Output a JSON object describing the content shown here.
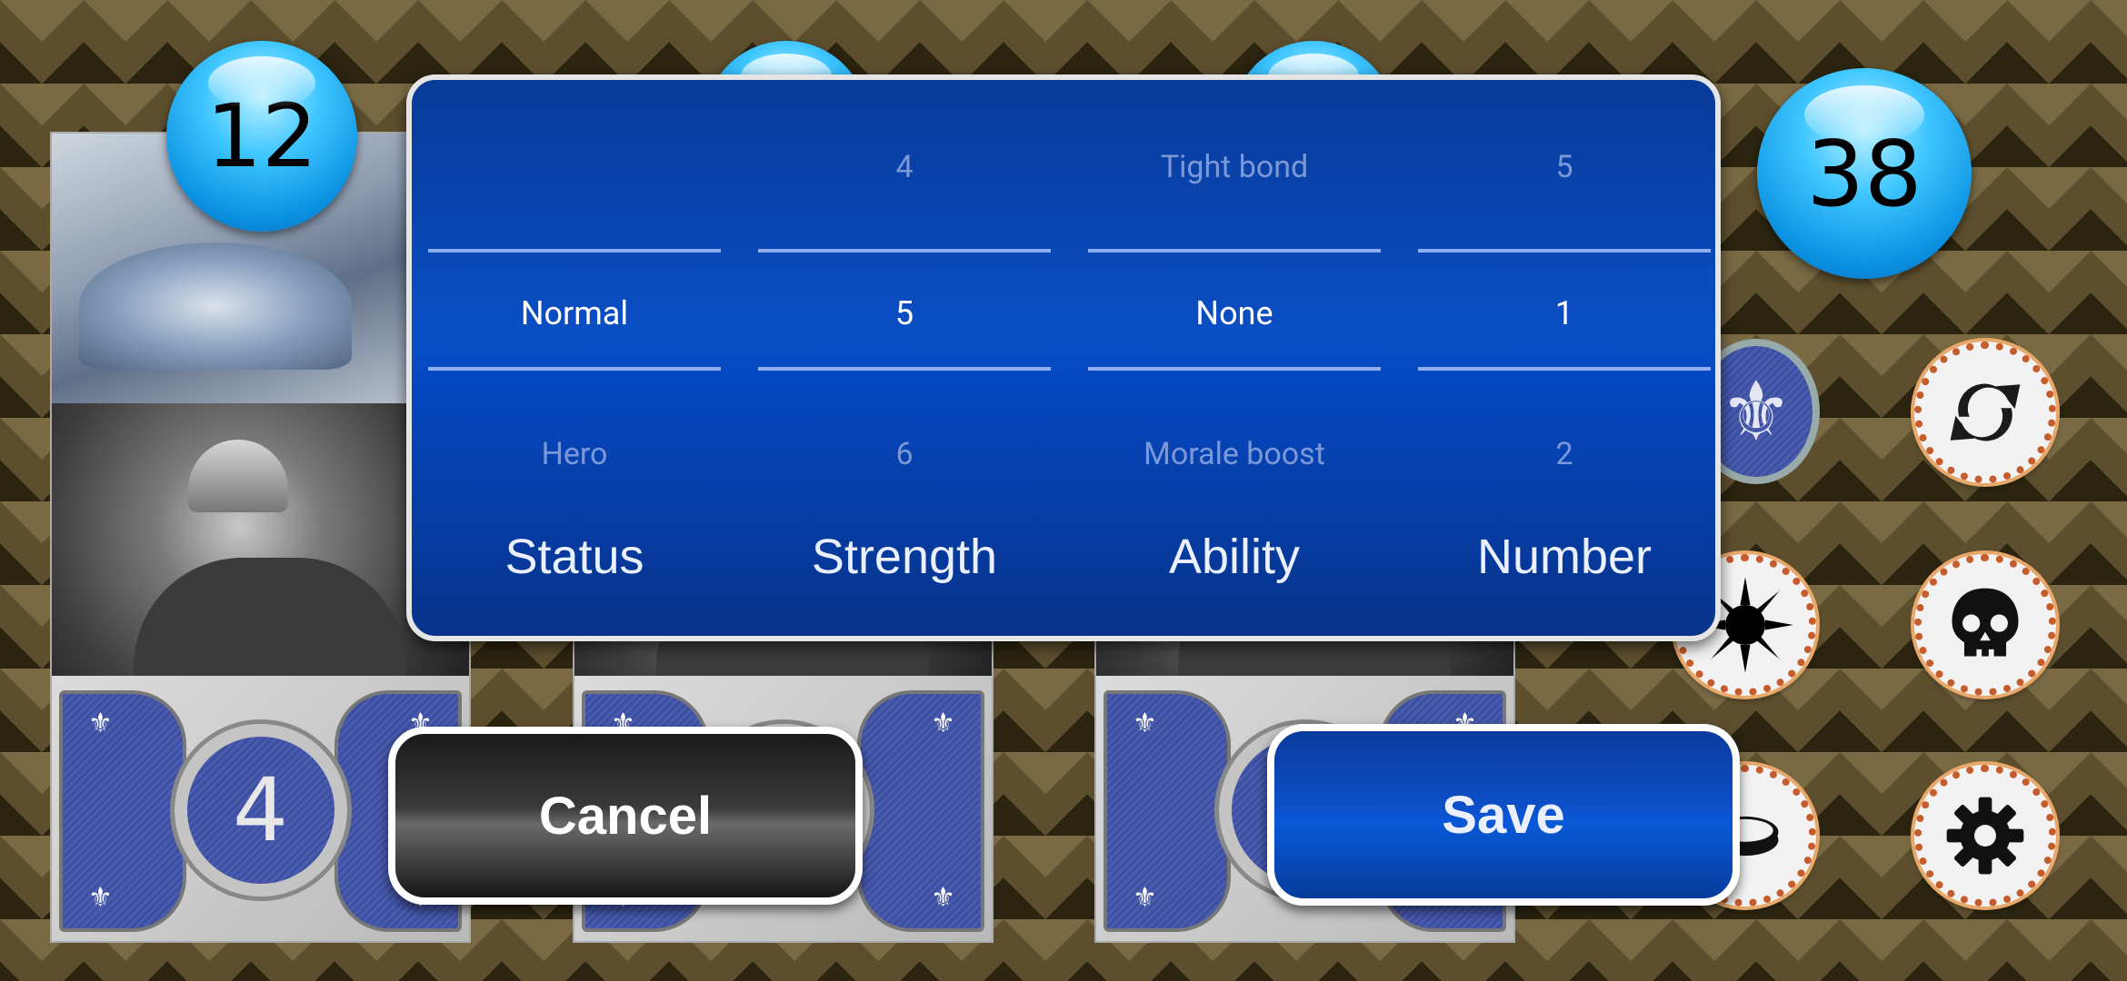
{
  "bubbles": {
    "left_value": "12",
    "right_value": "38"
  },
  "cards": [
    {
      "value": "4"
    },
    {
      "value": ""
    },
    {
      "value": ""
    }
  ],
  "picker": {
    "columns": [
      {
        "heading": "Status",
        "prev": "",
        "selected": "Normal",
        "next": "Hero"
      },
      {
        "heading": "Strength",
        "prev": "4",
        "selected": "5",
        "next": "6"
      },
      {
        "heading": "Ability",
        "prev": "Tight bond",
        "selected": "None",
        "next": "Morale boost"
      },
      {
        "heading": "Number",
        "prev": "5",
        "selected": "1",
        "next": "2"
      }
    ]
  },
  "buttons": {
    "cancel_label": "Cancel",
    "save_label": "Save"
  },
  "side_controls": [
    "fleur-de-lis-icon",
    "refresh-icon",
    "sun-icon",
    "skull-icon",
    "coin-icon",
    "gear-icon"
  ],
  "colors": {
    "dialog_blue": "#0a4ec4",
    "bubble_blue": "#3ec6ff",
    "cancel_black": "#1a1a1a",
    "save_blue": "#0d4fc8"
  }
}
